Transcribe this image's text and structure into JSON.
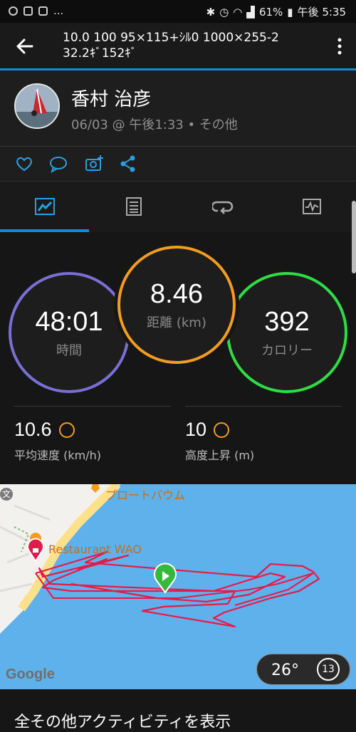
{
  "status_bar": {
    "battery": "61%",
    "time": "午後 5:35",
    "more": "..."
  },
  "app_bar": {
    "title_line1": "10.0 100 95×115+ｼﾙ0 1000×255-2",
    "title_line2": "32.2ｷﾞ152ｷﾞ"
  },
  "profile": {
    "name": "香村 治彦",
    "meta": "06/03 @ 午後1:33 • その他"
  },
  "stats": {
    "time": {
      "value": "48:01",
      "label": "時間"
    },
    "distance": {
      "value": "8.46",
      "label": "距離 (km)"
    },
    "calories": {
      "value": "392",
      "label": "カロリー"
    },
    "avg_speed": {
      "value": "10.6",
      "label": "平均速度 (km/h)"
    },
    "elevation_gain": {
      "value": "10",
      "label": "高度上昇 (m)"
    }
  },
  "map": {
    "poi1": "プロートバウム",
    "poi2": "Restaurant WAO",
    "place_badge": "文",
    "google": "Google",
    "weather_temp": "26°",
    "weather_clock": "13"
  },
  "bottom": {
    "link": "全その他アクティビティを表示"
  },
  "colors": {
    "accent": "#0a8fd4",
    "ring_time": "#7a6fd6",
    "ring_distance": "#f39c1f",
    "ring_calories": "#2fdc45",
    "route": "#e8194a"
  }
}
